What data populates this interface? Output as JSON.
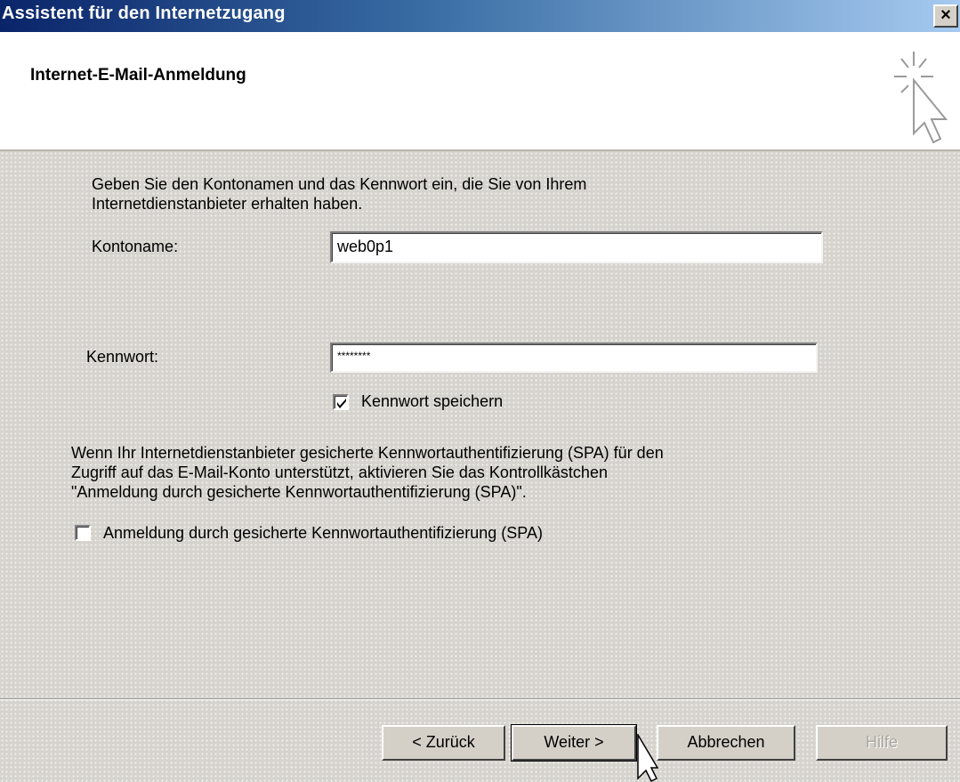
{
  "window": {
    "title": "Assistent für den Internetzugang",
    "close_label": "×"
  },
  "header": {
    "title": "Internet-E-Mail-Anmeldung",
    "icon": "wizard-cursor-icon"
  },
  "intro": {
    "line1": "Geben Sie den Kontonamen und das Kennwort ein, die Sie von Ihrem",
    "line2": "Internetdienstanbieter erhalten haben."
  },
  "account": {
    "label": "Kontoname:",
    "value": "web0p1"
  },
  "password": {
    "label": "Kennwort:",
    "value": "********"
  },
  "save_password": {
    "label": "Kennwort speichern",
    "checked": true
  },
  "spa": {
    "line1": "Wenn Ihr Internetdienstanbieter gesicherte Kennwortauthentifizierung (SPA) für den",
    "line2": "Zugriff auf das E-Mail-Konto unterstützt, aktivieren Sie das Kontrollkästchen",
    "line3": "\"Anmeldung durch gesicherte Kennwortauthentifizierung (SPA)\".",
    "checkbox_label": "Anmeldung durch gesicherte Kennwortauthentifizierung (SPA)",
    "checked": false
  },
  "buttons": {
    "back": "< Zurück",
    "next": "Weiter >",
    "cancel": "Abbrechen",
    "help": "Hilfe"
  }
}
